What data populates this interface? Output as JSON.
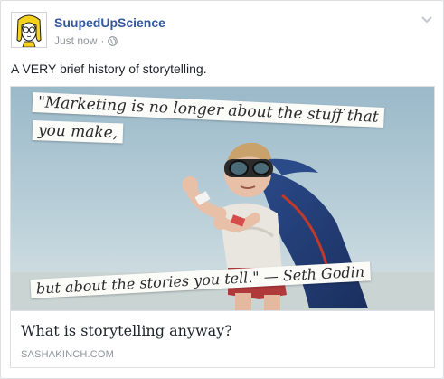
{
  "post": {
    "author": "SuupedUpScience",
    "timestamp": "Just now",
    "separator": "·",
    "privacy_icon": "globe-icon",
    "menu_icon": "chevron-down-icon",
    "text": "A VERY brief history of storytelling."
  },
  "link": {
    "image_quote_line1": "\"Marketing is no longer about the stuff that",
    "image_quote_line2": "you make,",
    "image_quote_line3": "but about the stories you tell.\" — Seth Godin",
    "title": "What is storytelling anyway?",
    "domain": "SASHAKINCH.COM"
  },
  "colors": {
    "name_blue": "#365899",
    "meta_gray": "#90949c",
    "text_dark": "#1d2129"
  }
}
